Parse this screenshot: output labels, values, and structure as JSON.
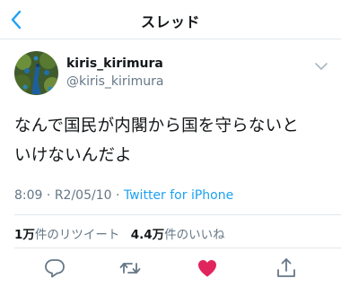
{
  "header": {
    "title": "スレッド"
  },
  "author": {
    "display_name": "kiris_kirimura",
    "handle": "@kiris_kirimura"
  },
  "tweet": {
    "text_line1": "なんで国民が内閣から国を守らないと",
    "text_line2": "いけないんだよ",
    "time": "8:09",
    "date": "R2/05/10",
    "via": "Twitter for iPhone"
  },
  "stats": {
    "retweets_count": "1万",
    "retweets_label": "件のリツイート",
    "likes_count": "4.4万",
    "likes_label": "件のいいね"
  },
  "colors": {
    "accent": "#1da1f2",
    "like": "#e0245e",
    "muted": "#657786",
    "text": "#14171a"
  },
  "icons": [
    "back-chevron-icon",
    "dropdown-caret-icon",
    "reply-icon",
    "retweet-icon",
    "heart-icon",
    "share-icon"
  ]
}
